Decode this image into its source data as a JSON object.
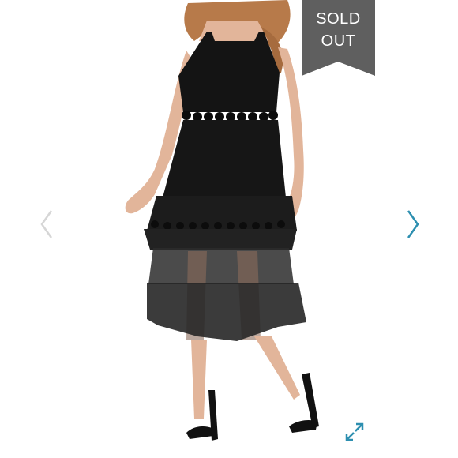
{
  "badge": {
    "line1": "SOLD",
    "line2": "OUT",
    "color": "#5f5f5f"
  },
  "product_image": {
    "subject": "model-wearing-black-tiered-ruffle-midi-dress",
    "background": "#ffffff"
  },
  "icons": {
    "prev": "chevron-left-icon",
    "next": "chevron-right-icon",
    "expand": "expand-icon"
  },
  "colors": {
    "prev_arrow": "#d6d6d6",
    "next_arrow": "#2d8fb0",
    "expand_icon": "#2d8fb0",
    "dress": "#141414",
    "skin": "#e2b59a",
    "hair": "#b77a4a"
  }
}
